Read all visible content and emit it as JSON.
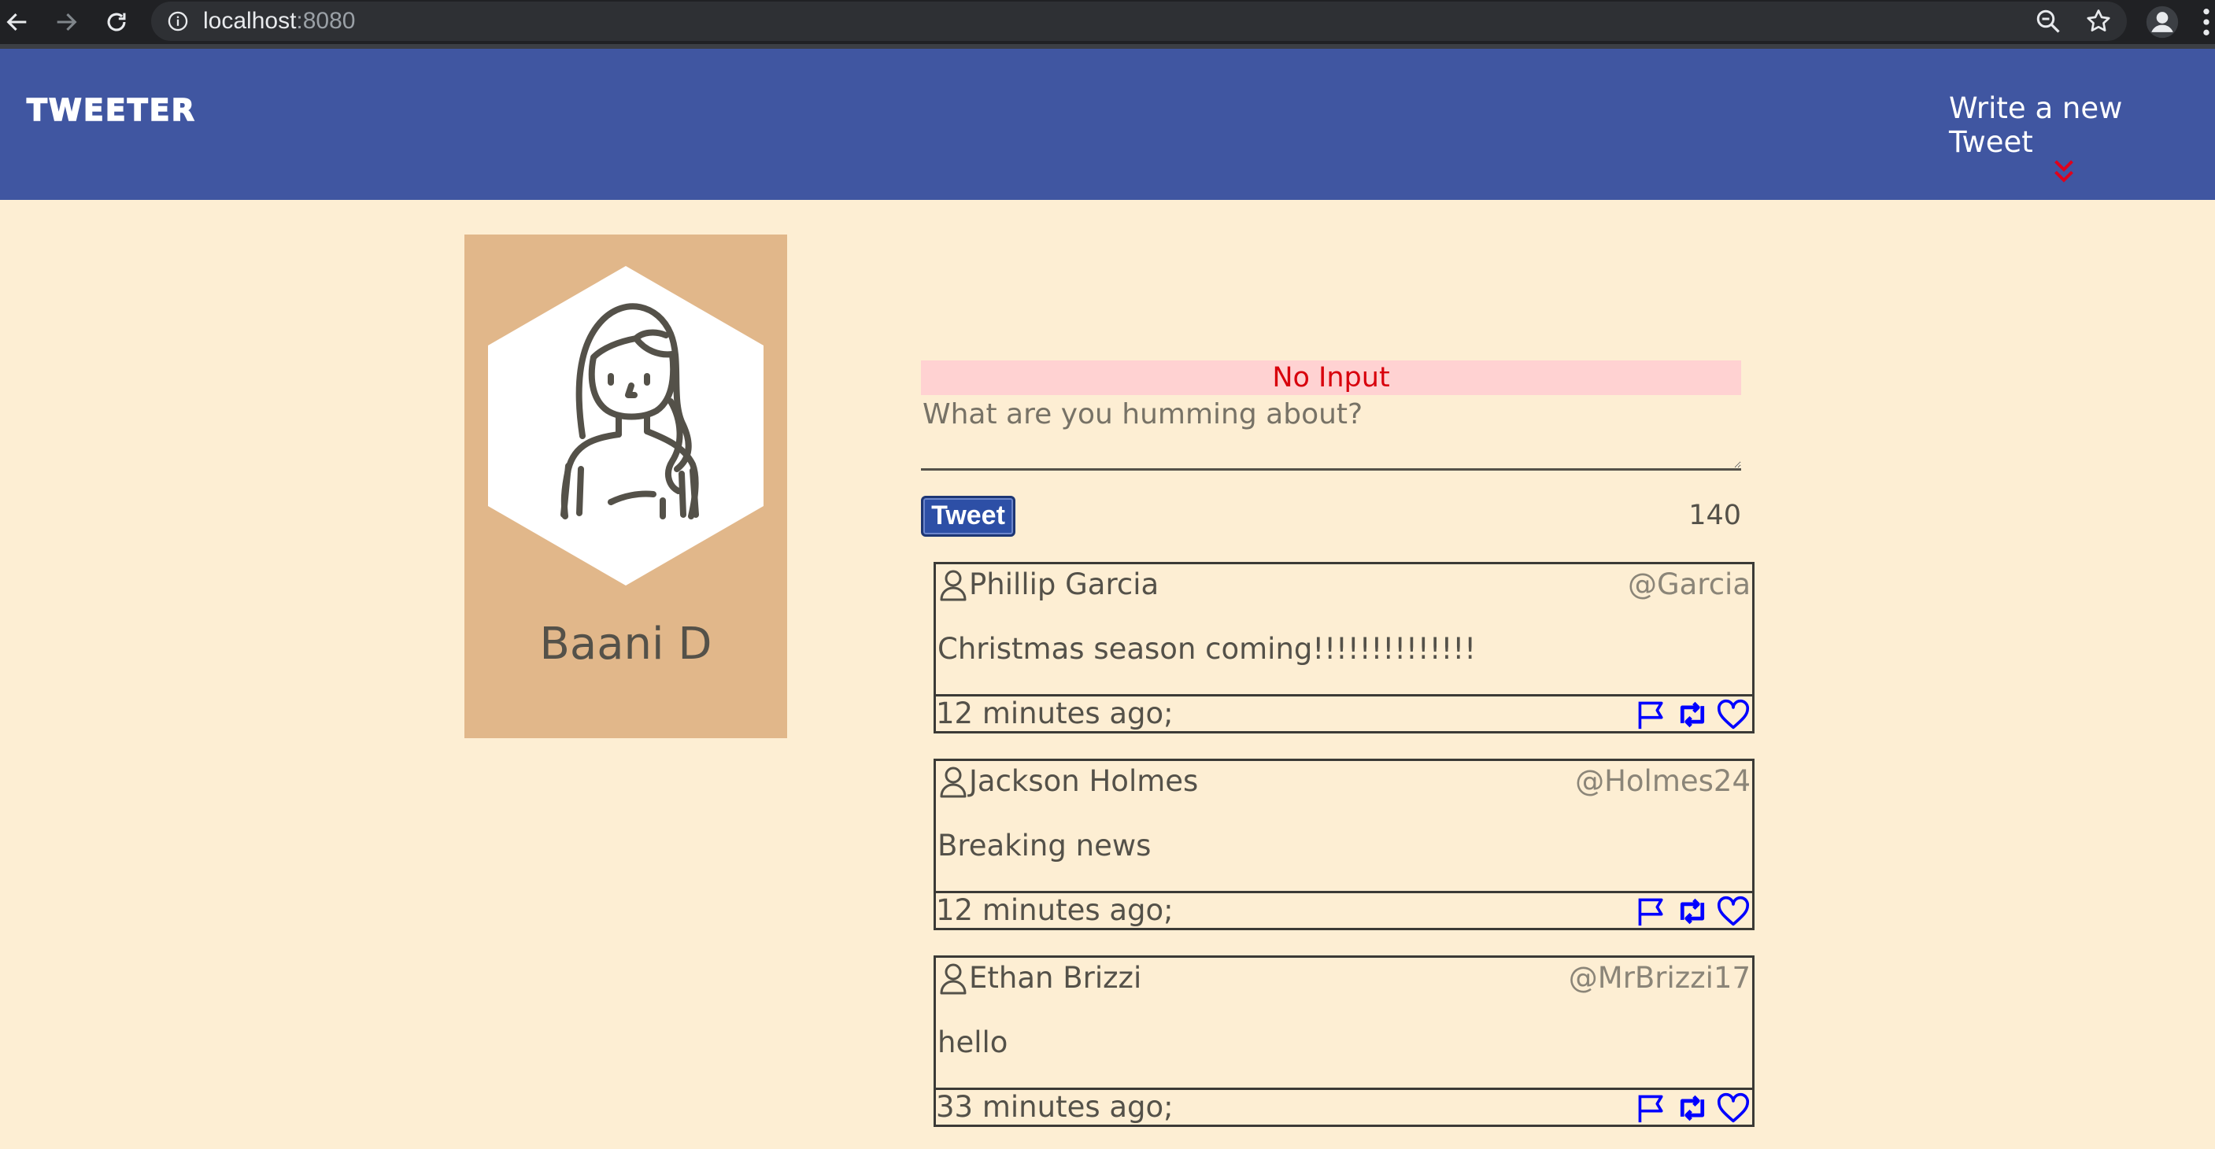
{
  "browser": {
    "url_host": "localhost",
    "url_port": ":8080"
  },
  "header": {
    "logo": "TWEETER",
    "compose_link": "Write a new Tweet"
  },
  "profile": {
    "name": "Baani D"
  },
  "compose": {
    "error_message": "No Input",
    "placeholder": "What are you humming about?",
    "tweet_button": "Tweet",
    "char_counter": "140"
  },
  "tweets": [
    {
      "name": "Phillip Garcia",
      "handle": "@Garcia",
      "content": "Christmas season coming!!!!!!!!!!!!!!",
      "time": "12 minutes ago;"
    },
    {
      "name": "Jackson Holmes",
      "handle": "@Holmes24",
      "content": "Breaking news",
      "time": "12 minutes ago;"
    },
    {
      "name": "Ethan Brizzi",
      "handle": "@MrBrizzi17",
      "content": "hello",
      "time": "33 minutes ago;"
    }
  ],
  "colors": {
    "header_bg": "#4056a1",
    "page_bg": "#fdeed3",
    "card_bg": "#e1b78a",
    "error_bg": "#ffd2d2",
    "error_text": "#d8000c",
    "action_icons": "#0000ff"
  }
}
